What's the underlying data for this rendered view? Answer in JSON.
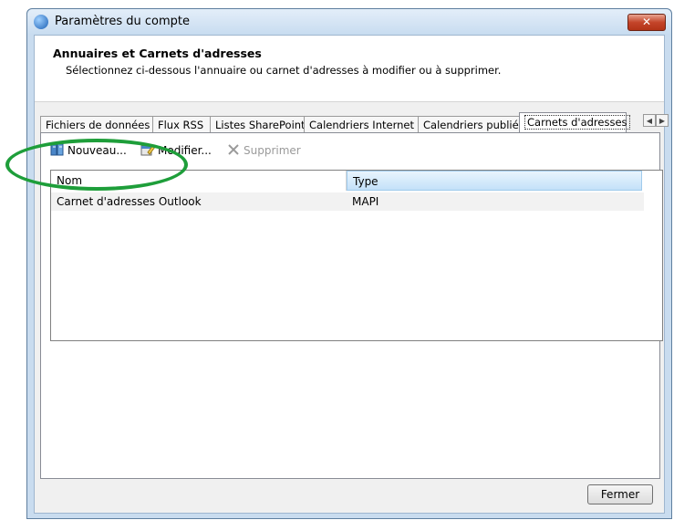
{
  "window": {
    "title": "Paramètres du compte",
    "close_symbol": "✕"
  },
  "header": {
    "title": "Annuaires et Carnets d'adresses",
    "subtitle": "Sélectionnez ci-dessous l'annuaire ou carnet d'adresses à modifier ou à supprimer."
  },
  "tabs": [
    {
      "label": "Fichiers de données"
    },
    {
      "label": "Flux RSS"
    },
    {
      "label": "Listes SharePoint"
    },
    {
      "label": "Calendriers Internet"
    },
    {
      "label": "Calendriers publiés"
    },
    {
      "label": "Carnets d'adresses",
      "active": true
    }
  ],
  "toolbar": {
    "new_label": "Nouveau...",
    "edit_label": "Modifier...",
    "delete_label": "Supprimer"
  },
  "list": {
    "columns": [
      "Nom",
      "Type"
    ],
    "rows": [
      {
        "name": "Carnet d'adresses Outlook",
        "type": "MAPI"
      }
    ]
  },
  "footer": {
    "close_label": "Fermer"
  },
  "colors": {
    "highlight": "#1e9e3a",
    "title_bar": "#c8dcf0"
  }
}
